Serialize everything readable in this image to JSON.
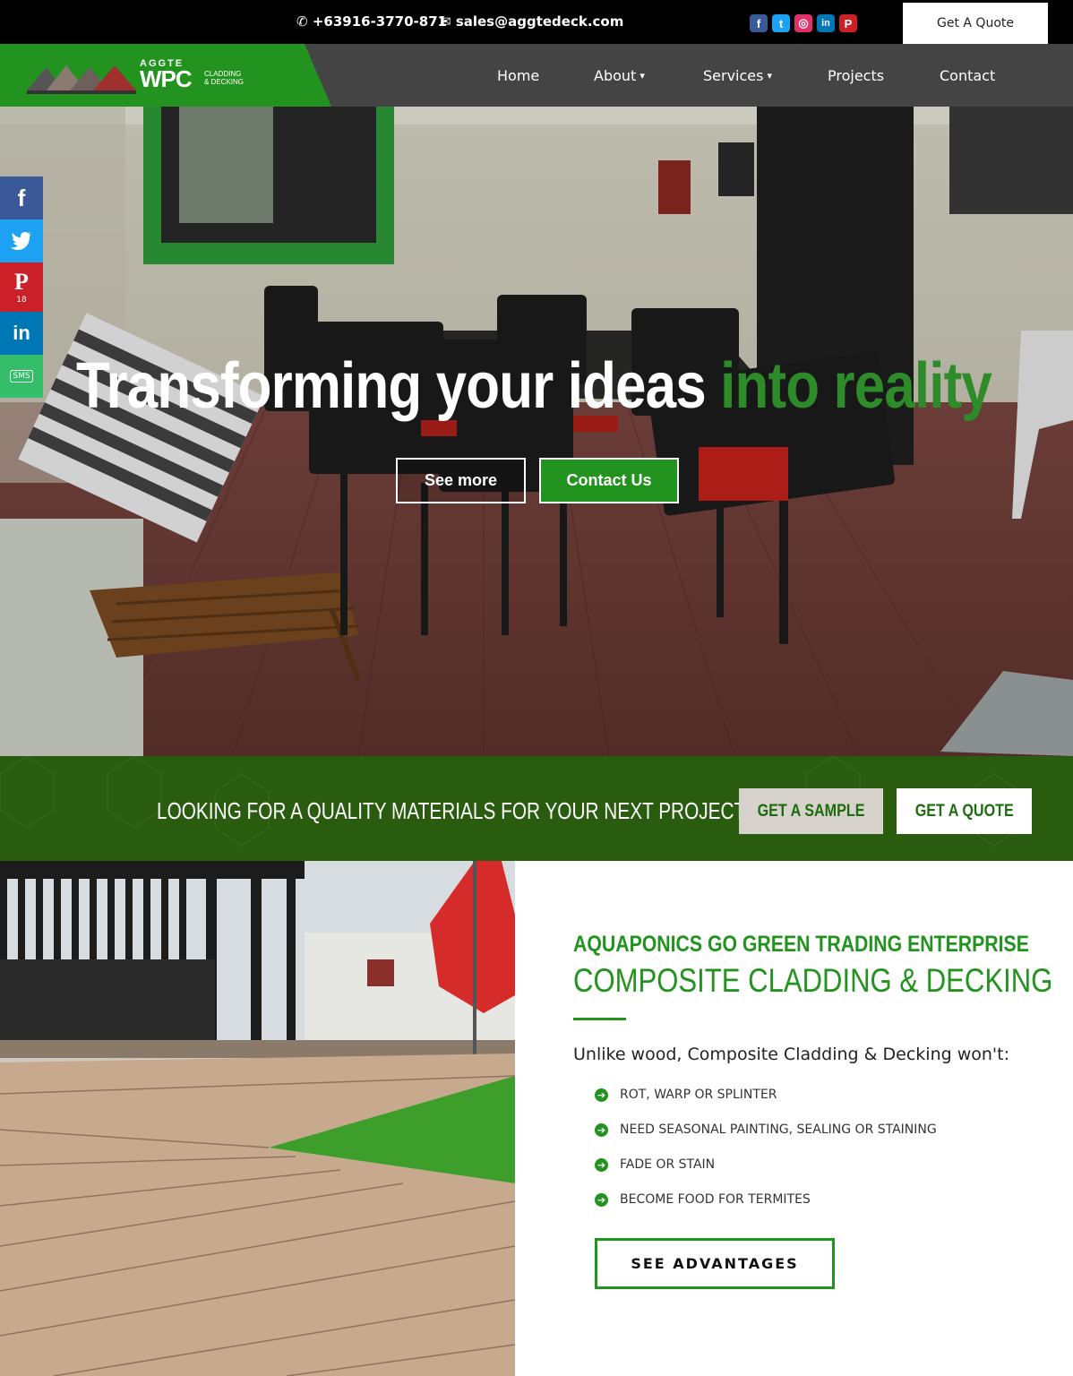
{
  "topbar": {
    "phone": "+63916-3770-871",
    "email": "sales@aggtedeck.com",
    "socials": [
      {
        "name": "facebook",
        "glyph": "f",
        "color": "#3b5998"
      },
      {
        "name": "twitter",
        "glyph": "t",
        "color": "#1da1f2"
      },
      {
        "name": "instagram",
        "glyph": "◎",
        "color": "#e1306c"
      },
      {
        "name": "linkedin",
        "glyph": "in",
        "color": "#0077b5"
      },
      {
        "name": "pinterest",
        "glyph": "P",
        "color": "#cb2027"
      }
    ],
    "quote_label": "Get A Quote"
  },
  "logo": {
    "top": "AGGTE",
    "main": "WPC",
    "sub1": "CLADDING",
    "sub2": "& DECKING"
  },
  "nav": {
    "home": "Home",
    "about": "About",
    "services": "Services",
    "projects": "Projects",
    "contact": "Contact",
    "caret": "▾"
  },
  "share_bar": [
    {
      "name": "facebook",
      "glyph": "f",
      "color": "#3b5998"
    },
    {
      "name": "twitter",
      "glyph": "🐦",
      "color": "#1da1f2"
    },
    {
      "name": "pinterest",
      "glyph": "P",
      "color": "#cb2027",
      "count": "18"
    },
    {
      "name": "linkedin",
      "glyph": "in",
      "color": "#0077b5"
    },
    {
      "name": "sms",
      "glyph": "SMS",
      "color": "#35be69"
    }
  ],
  "hero": {
    "title_white": "Transforming your ideas ",
    "title_green": "into reality",
    "see_more": "See more",
    "contact_us": "Contact Us"
  },
  "banner": {
    "text": "LOOKING FOR A QUALITY MATERIALS FOR YOUR NEXT PROJECT?",
    "sample_label": "GET A SAMPLE",
    "quote_label": "GET A QUOTE"
  },
  "about": {
    "kicker": "AQUAPONICS GO GREEN TRADING ENTERPRISE",
    "headline": "COMPOSITE CLADDING & DECKING",
    "lead": "Unlike wood, Composite Cladding & Decking won't:",
    "items": [
      "ROT, WARP OR SPLINTER",
      "NEED SEASONAL PAINTING, SEALING OR STAINING",
      "FADE OR STAIN",
      "BECOME FOOD FOR TERMITES"
    ],
    "button": "SEE ADVANTAGES"
  },
  "colors": {
    "brand_green": "#23931f",
    "banner_green": "#2a5c10",
    "nav_gray": "#444444"
  }
}
